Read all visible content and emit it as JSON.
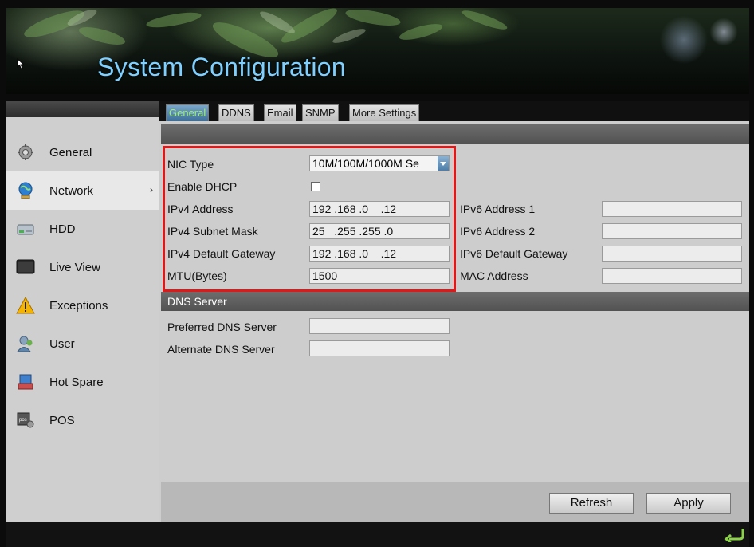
{
  "header": {
    "title": "System Configuration"
  },
  "sidebar": {
    "items": [
      {
        "label": "General",
        "icon": "gear-icon"
      },
      {
        "label": "Network",
        "icon": "network-globe-icon",
        "active": true,
        "arrow": "›"
      },
      {
        "label": "HDD",
        "icon": "hdd-icon"
      },
      {
        "label": "Live View",
        "icon": "monitor-icon"
      },
      {
        "label": "Exceptions",
        "icon": "warning-icon"
      },
      {
        "label": "User",
        "icon": "user-icon"
      },
      {
        "label": "Hot Spare",
        "icon": "hot-spare-icon"
      },
      {
        "label": "POS",
        "icon": "pos-icon"
      }
    ]
  },
  "tabs": [
    {
      "label": "General",
      "active": true
    },
    {
      "label": "DDNS"
    },
    {
      "label": "Email"
    },
    {
      "label": "SNMP"
    },
    {
      "label": "More Settings"
    }
  ],
  "form": {
    "nic_type": {
      "label": "NIC Type",
      "value": "10M/100M/1000M Se"
    },
    "enable_dhcp": {
      "label": "Enable DHCP",
      "checked": false
    },
    "ipv4_address": {
      "label": "IPv4 Address",
      "value": "192 .168 .0    .12"
    },
    "ipv4_subnet_mask": {
      "label": "IPv4 Subnet Mask",
      "value": "25   .255 .255 .0"
    },
    "ipv4_default_gateway": {
      "label": "IPv4 Default Gateway",
      "value": "192 .168 .0    .12"
    },
    "mtu": {
      "label": "MTU(Bytes)",
      "value": "1500"
    },
    "ipv6_address_1": {
      "label": "IPv6 Address 1",
      "value": ""
    },
    "ipv6_address_2": {
      "label": "IPv6 Address 2",
      "value": ""
    },
    "ipv6_default_gateway": {
      "label": "IPv6 Default Gateway",
      "value": ""
    },
    "mac_address": {
      "label": "MAC Address",
      "value": ""
    }
  },
  "dns": {
    "section_title": "DNS Server",
    "preferred": {
      "label": "Preferred DNS Server",
      "value": ""
    },
    "alternate": {
      "label": "Alternate DNS Server",
      "value": ""
    }
  },
  "buttons": {
    "refresh": "Refresh",
    "apply": "Apply"
  },
  "colors": {
    "title": "#7fd0ff",
    "active_tab_text": "#9ff07a",
    "highlight": "#e01818"
  }
}
